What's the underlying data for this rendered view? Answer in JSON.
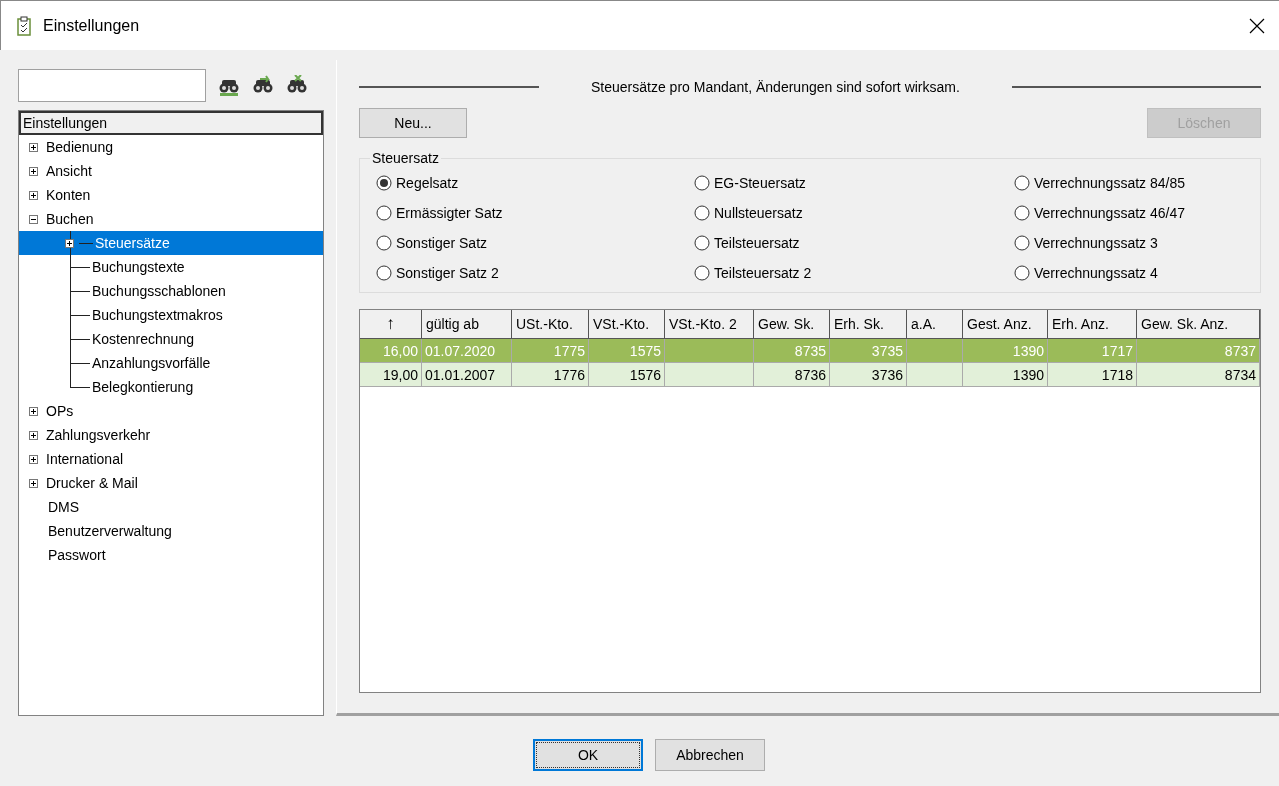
{
  "window": {
    "title": "Einstellungen"
  },
  "tree": {
    "root": {
      "label": "Einstellungen",
      "selected": false
    },
    "items": [
      {
        "label": "Bedienung",
        "expanded": false,
        "selected": false
      },
      {
        "label": "Ansicht",
        "expanded": false,
        "selected": false
      },
      {
        "label": "Konten",
        "expanded": false,
        "selected": false
      },
      {
        "label": "Buchen",
        "expanded": true,
        "selected": false,
        "children": [
          {
            "label": "Steuersätze",
            "expanded": false,
            "selected": true
          },
          {
            "label": "Buchungstexte",
            "selected": false
          },
          {
            "label": "Buchungsschablonen",
            "selected": false
          },
          {
            "label": "Buchungstextmakros",
            "selected": false
          },
          {
            "label": "Kostenrechnung",
            "selected": false
          },
          {
            "label": "Anzahlungsvorfälle",
            "selected": false
          },
          {
            "label": "Belegkontierung",
            "selected": false
          }
        ]
      },
      {
        "label": "OPs",
        "expanded": false,
        "selected": false
      },
      {
        "label": "Zahlungsverkehr",
        "expanded": false,
        "selected": false
      },
      {
        "label": "International",
        "expanded": false,
        "selected": false
      },
      {
        "label": "Drucker & Mail",
        "expanded": false,
        "selected": false
      },
      {
        "label": "DMS",
        "selected": false
      },
      {
        "label": "Benutzerverwaltung",
        "selected": false
      },
      {
        "label": "Passwort",
        "selected": false
      }
    ]
  },
  "panel": {
    "heading": "Steuersätze pro Mandant, Änderungen sind sofort wirksam.",
    "new_button": {
      "label": "Neu...",
      "disabled": false
    },
    "delete_button": {
      "label": "Löschen",
      "disabled": true
    },
    "group": {
      "title": "Steuersatz",
      "options": [
        {
          "label": "Regelsatz",
          "selected": true
        },
        {
          "label": "EG-Steuersatz",
          "selected": false
        },
        {
          "label": "Verrechnungssatz 84/85",
          "selected": false
        },
        {
          "label": "Ermässigter Satz",
          "selected": false
        },
        {
          "label": "Nullsteuersatz",
          "selected": false
        },
        {
          "label": "Verrechnungssatz 46/47",
          "selected": false
        },
        {
          "label": "Sonstiger Satz",
          "selected": false
        },
        {
          "label": "Teilsteuersatz",
          "selected": false
        },
        {
          "label": "Verrechnungssatz 3",
          "selected": false
        },
        {
          "label": "Sonstiger Satz 2",
          "selected": false
        },
        {
          "label": "Teilsteuersatz 2",
          "selected": false
        },
        {
          "label": "Verrechnungssatz 4",
          "selected": false
        }
      ]
    },
    "table": {
      "columns": [
        "↑",
        "gültig ab",
        "USt.-Kto.",
        "VSt.-Kto.",
        "VSt.-Kto. 2",
        "Gew. Sk.",
        "Erh. Sk.",
        "a.A.",
        "Gest. Anz.",
        "Erh. Anz.",
        "Gew. Sk. Anz."
      ],
      "rows": [
        {
          "selected": true,
          "cells": [
            "16,00",
            "01.07.2020",
            "1775",
            "1575",
            "",
            "8735",
            "3735",
            "",
            "1390",
            "1717",
            "8737"
          ]
        },
        {
          "selected": false,
          "cells": [
            "19,00",
            "01.01.2007",
            "1776",
            "1576",
            "",
            "8736",
            "3736",
            "",
            "1390",
            "1718",
            "8734"
          ]
        }
      ]
    }
  },
  "buttons": [
    {
      "label": "OK",
      "default": true
    },
    {
      "label": "Abbrechen",
      "default": false
    }
  ]
}
